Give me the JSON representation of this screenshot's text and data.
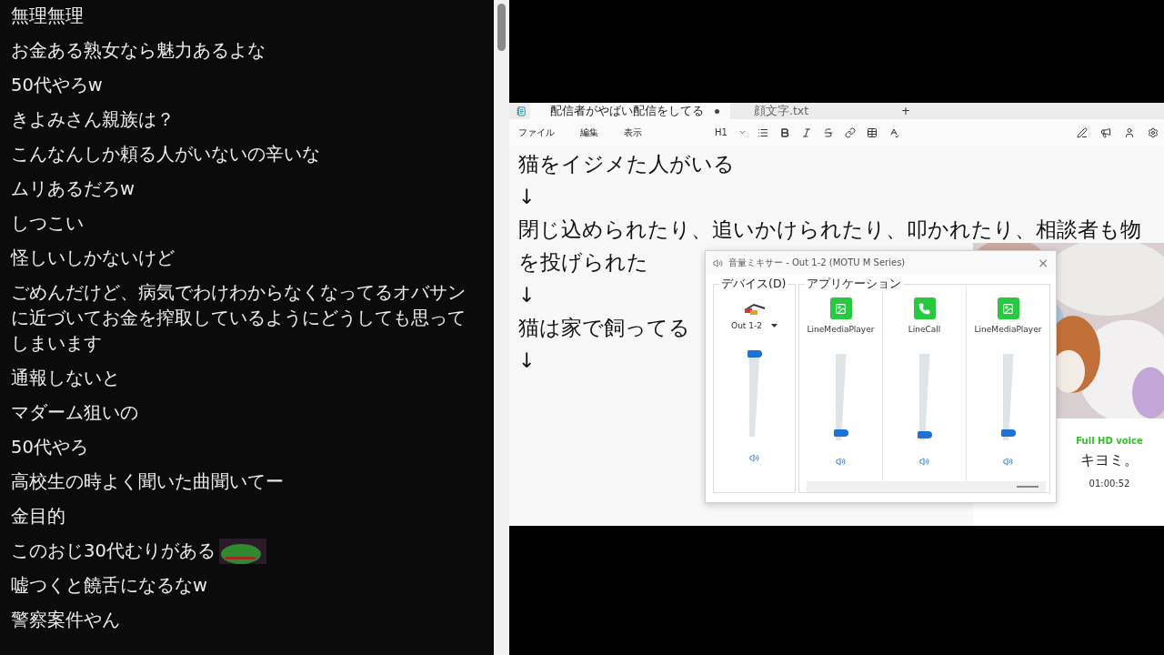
{
  "chat": {
    "messages": [
      {
        "text": "無理無理"
      },
      {
        "text": "お金ある熟女なら魅力あるよな"
      },
      {
        "text": "50代やろw"
      },
      {
        "text": "きよみさん親族は？"
      },
      {
        "text": "こんなんしか頼る人がいないの辛いな"
      },
      {
        "text": "ムリあるだろw"
      },
      {
        "text": "しつこい"
      },
      {
        "text": "怪しいしかないけど"
      },
      {
        "text": "ごめんだけど、病気でわけわからなくなってるオバサンに近づいてお金を搾取しているようにどうしても思ってしまいます"
      },
      {
        "text": "通報しないと"
      },
      {
        "text": "マダーム狙いの"
      },
      {
        "text": "50代やろ"
      },
      {
        "text": "高校生の時よく聞いた曲聞いてー"
      },
      {
        "text": "金目的"
      },
      {
        "text": "このおじ30代むりがある",
        "emote": true
      },
      {
        "text": "嘘つくと饒舌になるなw"
      },
      {
        "text": "警察案件やん"
      }
    ]
  },
  "editor": {
    "tabs": [
      {
        "label": "配信者がやばい配信をしてる",
        "selected": true,
        "modified": true
      },
      {
        "label": "顔文字.txt",
        "selected": false,
        "modified": false
      }
    ],
    "new_tab": "+",
    "menu": [
      "ファイル",
      "編集",
      "表示"
    ],
    "heading": "H1",
    "lines": [
      "猫をイジメた人がいる",
      "↓",
      "閉じ込められたり、追いかけられたり、叩かれたり、相談者も物",
      "を投げられた",
      "↓",
      "猫は家で飼ってる",
      "↓"
    ]
  },
  "mixer": {
    "title": "音量ミキサー - Out 1-2 (MOTU M Series)",
    "close": "×",
    "device_group": "デバイス(D)",
    "app_group": "アプリケーション",
    "device": {
      "name": "Out 1-2",
      "level": 1.0
    },
    "apps": [
      {
        "name": "LineMediaPlayer",
        "kind": "media",
        "level": 0.05
      },
      {
        "name": "LineCall",
        "kind": "call",
        "level": 0.02
      },
      {
        "name": "LineMediaPlayer",
        "kind": "media",
        "level": 0.05
      }
    ]
  },
  "call": {
    "quality": "Full HD voice",
    "name": "キヨミ。",
    "duration": "01:00:52"
  }
}
